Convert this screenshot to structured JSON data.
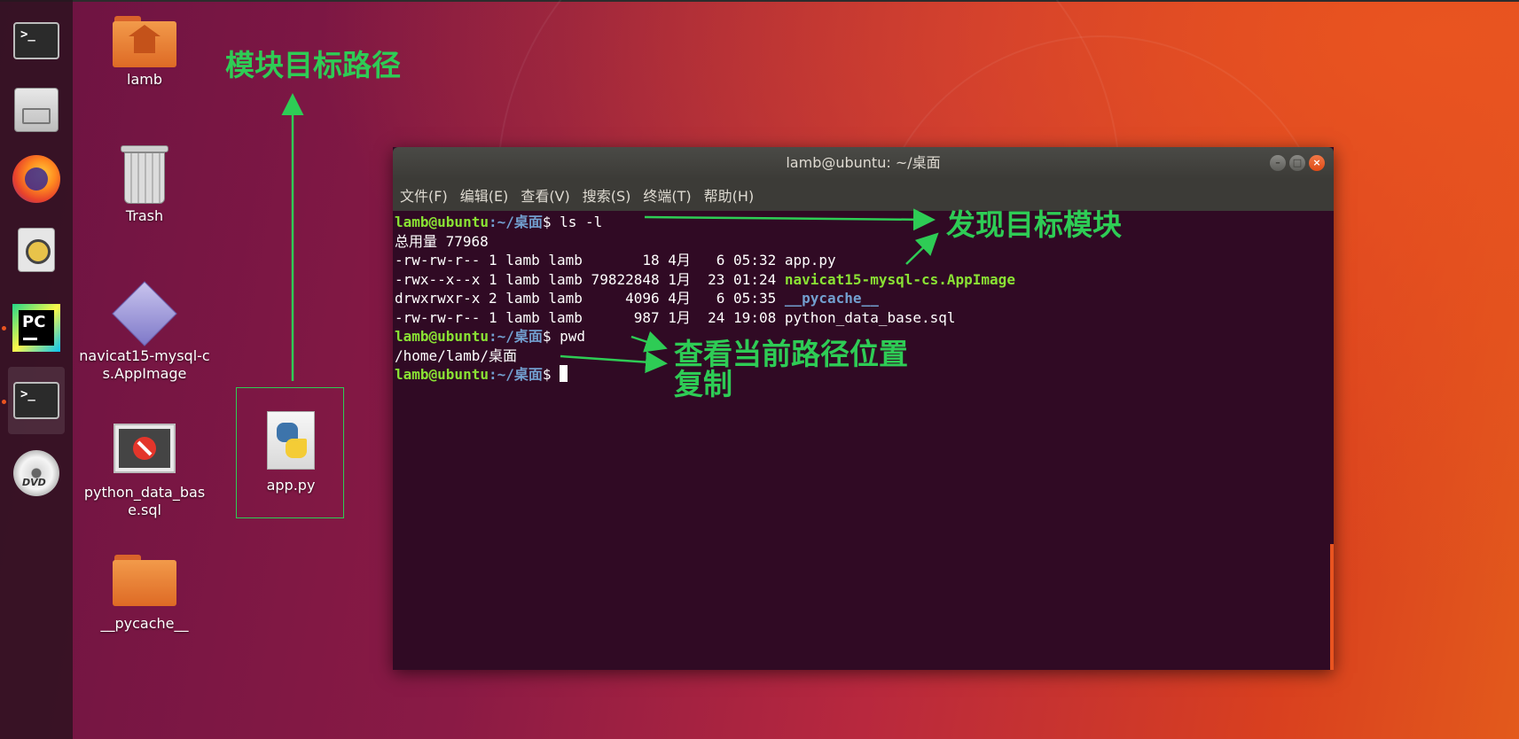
{
  "dock": {
    "items": [
      {
        "name": "terminal",
        "icon": "terminal-icon",
        "prompt": ">_"
      },
      {
        "name": "files",
        "icon": "files-icon"
      },
      {
        "name": "firefox",
        "icon": "firefox-icon"
      },
      {
        "name": "rhythmbox",
        "icon": "rhythmbox-icon"
      },
      {
        "name": "pycharm",
        "icon": "pycharm-icon",
        "text": "PC"
      },
      {
        "name": "terminal-active",
        "icon": "terminal-icon",
        "prompt": ">_"
      },
      {
        "name": "dvd",
        "icon": "dvd-icon",
        "text": "DVD"
      }
    ],
    "accent": "#e95420"
  },
  "desktop": {
    "icons": [
      {
        "label": "lamb",
        "icon": "home-folder-icon"
      },
      {
        "label": "Trash",
        "icon": "trash-icon"
      },
      {
        "label": "navicat15-mysql-cs.AppImage",
        "icon": "appimage-icon"
      },
      {
        "label": "python_data_base.sql",
        "icon": "sql-file-icon"
      },
      {
        "label": "__pycache__",
        "icon": "folder-icon"
      },
      {
        "label": "app.py",
        "icon": "python-file-icon"
      }
    ]
  },
  "terminal": {
    "title": "lamb@ubuntu: ~/桌面",
    "menu": [
      "文件(F)",
      "编辑(E)",
      "查看(V)",
      "搜索(S)",
      "终端(T)",
      "帮助(H)"
    ],
    "prompt_user": "lamb@ubuntu",
    "prompt_path": ":~/桌面",
    "prompt_sign": "$",
    "cmd1": " ls -l",
    "total": "总用量 77968",
    "rows": [
      {
        "meta": "-rw-rw-r-- 1 lamb lamb       18 4月   6 05:32 ",
        "name": "app.py",
        "kind": "file"
      },
      {
        "meta": "-rwx--x--x 1 lamb lamb 79822848 1月  23 01:24 ",
        "name": "navicat15-mysql-cs.AppImage",
        "kind": "exe"
      },
      {
        "meta": "drwxrwxr-x 2 lamb lamb     4096 4月   6 05:35 ",
        "name": "__pycache__",
        "kind": "dir"
      },
      {
        "meta": "-rw-rw-r-- 1 lamb lamb      987 1月  24 19:08 ",
        "name": "python_data_base.sql",
        "kind": "file"
      }
    ],
    "cmd2": " pwd",
    "pwd_output": "/home/lamb/桌面",
    "colors": {
      "bg": "#300a24",
      "user": "#8ae234",
      "path": "#729fcf"
    }
  },
  "annotations": {
    "target_path": "模块目标路径",
    "found_module": "发现目标模块",
    "view_path": "查看当前路径位置",
    "copy": "复制",
    "color": "#2ecc55"
  }
}
